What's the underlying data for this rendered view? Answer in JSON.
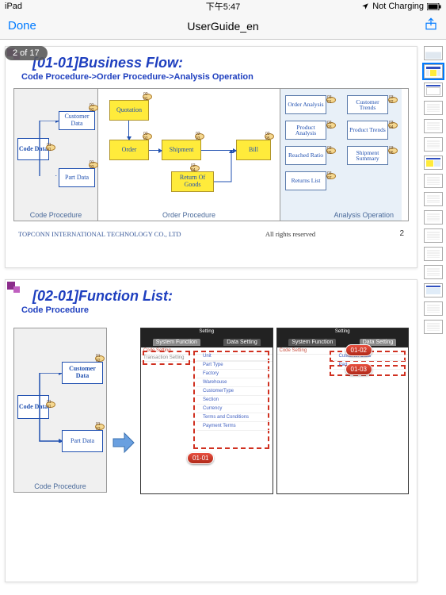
{
  "status": {
    "carrier": "iPad",
    "wifi": true,
    "time": "下午5:47",
    "loc": true,
    "battery": "Not Charging"
  },
  "nav": {
    "done": "Done",
    "title": "UserGuide_en"
  },
  "pageIndicator": "2 of 17",
  "slide1": {
    "title": "[01-01]Business Flow:",
    "subtitle": "Code Procedure->Order Procedure->Analysis Operation",
    "col1Label": "Code Procedure",
    "col2Label": "Order Procedure",
    "col3Label": "Analysis Operation",
    "codeData": "Code\nData",
    "custData": "Customer\nData",
    "partData": "Part\nData",
    "quotation": "Quotation",
    "order": "Order",
    "shipment": "Shipment",
    "returnGoods": "Return Of\nGoods",
    "bill": "Bill",
    "analysis": {
      "orderAnalysis": "Order\nAnalysis",
      "customerTrends": "Customer\nTrends",
      "productAnalysis": "Product\nAnalysis",
      "productTrends": "Product\nTrends",
      "reachedRatio": "Reached\nRatio",
      "shipmentSummary": "Shipment\nSummary",
      "returnsList": "Returns\nList"
    },
    "tags": {
      "t0101": "01-01",
      "t0102": "01-02",
      "t0103": "01-03",
      "t0201": "02-01",
      "t0202": "02-02",
      "t0203": "02-03",
      "t0204": "02-04",
      "t0205": "02-05",
      "t0301": "03-01",
      "t0302": "03-02",
      "t0303": "03-03",
      "t0304": "03-04",
      "t0305": "03-05",
      "t0306": "03-06",
      "t0307": "03-07"
    }
  },
  "footer": {
    "company": "TOPCONN INTERNATIONAL TECHNOLOGY CO., LTD",
    "rights": "All rights reserved",
    "page": "2"
  },
  "slide2": {
    "title": "[02-01]Function List:",
    "subtitle": "Code Procedure",
    "codeData": "Code\nData",
    "custData": "Customer\nData",
    "partData": "Part\nData",
    "colLabel": "Code Procedure",
    "tags": {
      "t0101": "01-01",
      "t0102": "01-02",
      "t0103": "01-03"
    },
    "shotA": {
      "topTitle": "Setting",
      "tabs": [
        "System Function",
        "Data Setting"
      ],
      "groups": [
        "Code Setting",
        "Transaction Setting"
      ],
      "items": [
        "Unit",
        "Part Type",
        "Factory",
        "Warehouse",
        "CustomerType",
        "Section",
        "Currency",
        "Terms and Conditions",
        "Payment Terms"
      ],
      "badge": "01-01"
    },
    "shotB": {
      "topTitle": "Setting",
      "tabs": [
        "System Function",
        "Data Setting"
      ],
      "groups": [
        "Code Setting"
      ],
      "items": [
        "Customer Data",
        "Part"
      ],
      "badge1": "01-02",
      "badge2": "01-03"
    }
  },
  "thumbs": {
    "count": 16,
    "selected": 1
  }
}
